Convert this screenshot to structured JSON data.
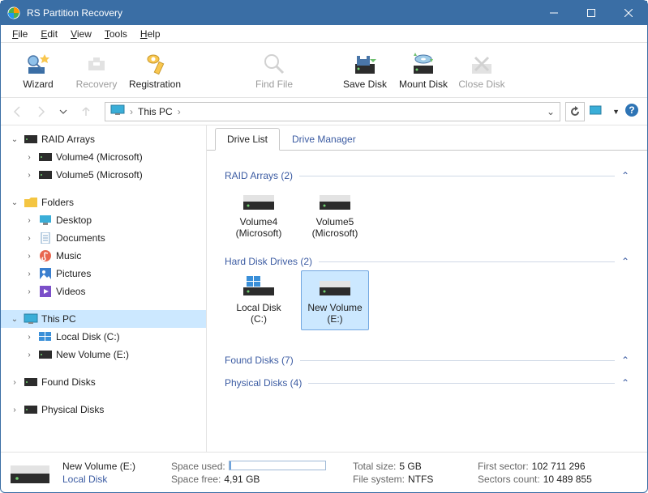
{
  "window": {
    "title": "RS Partition Recovery"
  },
  "menu": {
    "file": "File",
    "edit": "Edit",
    "view": "View",
    "tools": "Tools",
    "help": "Help"
  },
  "toolbar": {
    "wizard": "Wizard",
    "recovery": "Recovery",
    "registration": "Registration",
    "findfile": "Find File",
    "savedisk": "Save Disk",
    "mountdisk": "Mount Disk",
    "closedisk": "Close Disk"
  },
  "address": {
    "location": "This PC",
    "chevron": "›"
  },
  "tree": {
    "raidarrays": {
      "label": "RAID Arrays",
      "children": [
        {
          "label": "Volume4 (Microsoft)"
        },
        {
          "label": "Volume5 (Microsoft)"
        }
      ]
    },
    "folders": {
      "label": "Folders",
      "children": [
        {
          "label": "Desktop"
        },
        {
          "label": "Documents"
        },
        {
          "label": "Music"
        },
        {
          "label": "Pictures"
        },
        {
          "label": "Videos"
        }
      ]
    },
    "thispc": {
      "label": "This PC",
      "children": [
        {
          "label": "Local Disk (C:)"
        },
        {
          "label": "New Volume (E:)"
        }
      ]
    },
    "founddisks": {
      "label": "Found Disks"
    },
    "physicaldisks": {
      "label": "Physical Disks"
    }
  },
  "tabs": {
    "drivelist": "Drive List",
    "drivemanager": "Drive Manager"
  },
  "view": {
    "raidgroup": {
      "label": "RAID Arrays (2)",
      "items": [
        {
          "name": "Volume4",
          "sub": "(Microsoft)"
        },
        {
          "name": "Volume5",
          "sub": "(Microsoft)"
        }
      ]
    },
    "hddgroup": {
      "label": "Hard Disk Drives (2)",
      "items": [
        {
          "name": "Local Disk (C:)",
          "sub": ""
        },
        {
          "name": "New Volume (E:)",
          "sub": ""
        }
      ]
    },
    "foundgroup": {
      "label": "Found Disks (7)"
    },
    "physgroup": {
      "label": "Physical Disks (4)"
    }
  },
  "status": {
    "vol_name": "New Volume (E:)",
    "vol_type": "Local Disk",
    "space_used_label": "Space used:",
    "space_used_pct": 2,
    "space_free_label": "Space free:",
    "space_free_val": "4,91 GB",
    "total_size_label": "Total size:",
    "total_size_val": "5 GB",
    "fs_label": "File system:",
    "fs_val": "NTFS",
    "first_sector_label": "First sector:",
    "first_sector_val": "102 711 296",
    "sectors_count_label": "Sectors count:",
    "sectors_count_val": "10 489 855"
  }
}
